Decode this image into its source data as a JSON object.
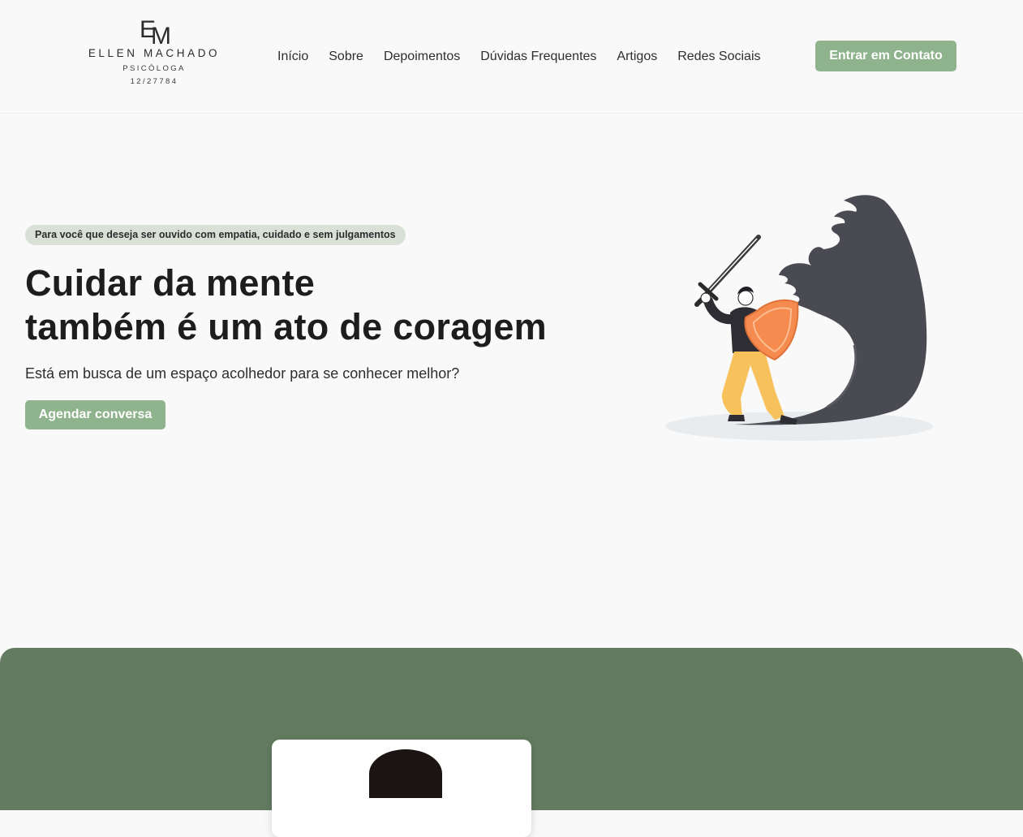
{
  "logo": {
    "monogram_e": "E",
    "monogram_m": "M",
    "name": "ELLEN MACHADO",
    "role": "PSICÓLOGA",
    "crp": "12/27784"
  },
  "nav": {
    "items": [
      "Início",
      "Sobre",
      "Depoimentos",
      "Dúvidas Frequentes",
      "Artigos",
      "Redes Sociais"
    ],
    "contact_label": "Entrar em Contato"
  },
  "hero": {
    "tagline": "Para você que deseja ser ouvido com empatia, cuidado e sem julgamentos",
    "headline_line1": "Cuidar da mente",
    "headline_line2": "também é um ato de coragem",
    "subtext": "Está em busca de um espaço acolhedor para se conhecer melhor?",
    "cta_label": "Agendar conversa"
  },
  "colors": {
    "accent_green": "#8fb38d",
    "section_green": "#637b61",
    "tag_bg": "#d9e1d7",
    "shield_orange": "#f58b4e",
    "pants_yellow": "#f7c25c",
    "shadow_dark": "#4a4a52"
  },
  "icons": {
    "hero_illustration": "person-with-sword-and-shield-vs-shadow-monster"
  }
}
